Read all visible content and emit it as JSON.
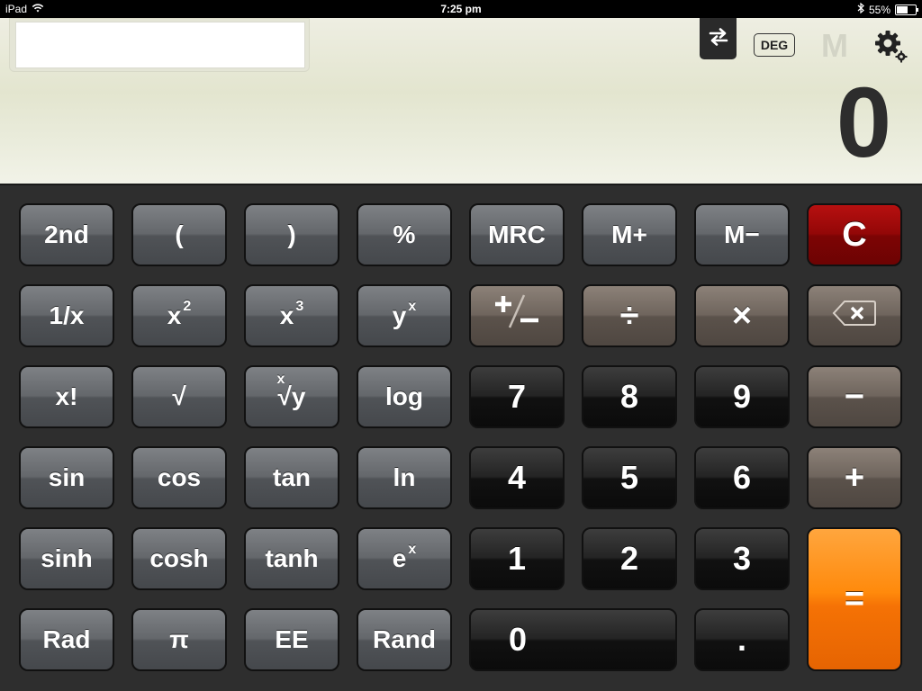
{
  "status_bar": {
    "device": "iPad",
    "time": "7:25 pm",
    "battery": "55%",
    "battery_level": 0.55
  },
  "display": {
    "history": "",
    "angle_mode": "DEG",
    "memory_indicator": "M",
    "result": "0"
  },
  "keys": {
    "second": "2nd",
    "open_paren": "(",
    "close_paren": ")",
    "percent": "%",
    "mrc": "MRC",
    "m_plus": "M+",
    "m_minus": "M−",
    "clear": "C",
    "reciprocal": "1/x",
    "x": "x",
    "sq_exp": "2",
    "cube_exp": "3",
    "y": "y",
    "pow_exp": "x",
    "plus_minus": "+∕−",
    "divide": "÷",
    "multiply": "×",
    "seven": "7",
    "eight": "8",
    "nine": "9",
    "minus": "−",
    "factorial": "x!",
    "sqrt": "√",
    "root_index": "x",
    "root_radical": "√y",
    "log": "log",
    "sin": "sin",
    "cos": "cos",
    "tan": "tan",
    "ln": "ln",
    "four": "4",
    "five": "5",
    "six": "6",
    "plus": "+",
    "sinh": "sinh",
    "cosh": "cosh",
    "tanh": "tanh",
    "e": "e",
    "exp_sup": "x",
    "one": "1",
    "two": "2",
    "three": "3",
    "equals": "=",
    "rad": "Rad",
    "pi": "π",
    "ee": "EE",
    "rand": "Rand",
    "zero": "0",
    "decimal": "."
  },
  "icons": {
    "swap": "swap-arrows-icon",
    "settings": "gear-icon",
    "backspace": "backspace-icon",
    "wifi": "wifi-icon",
    "bluetooth": "bluetooth-icon"
  }
}
